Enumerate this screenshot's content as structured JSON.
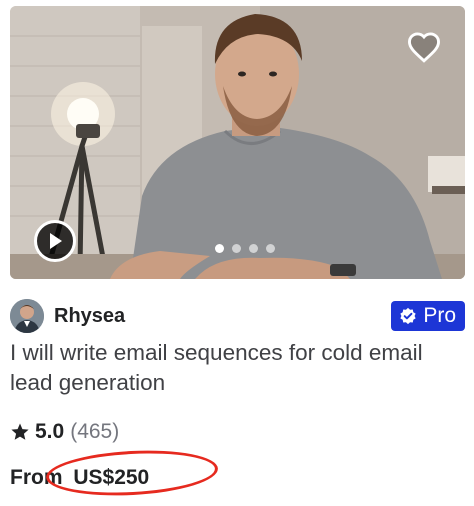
{
  "gig": {
    "seller_name": "Rhysea",
    "badge_label": "Pro",
    "title": "I will write email sequences for cold email lead generation",
    "rating": "5.0",
    "review_count": "(465)",
    "price_prefix": "From",
    "price": "US$250"
  },
  "media": {
    "slides": 4,
    "active_slide": 1
  },
  "icons": {
    "favorite": "heart-outline-icon",
    "play": "play-icon",
    "badge": "verified-check-icon",
    "rating": "star-icon"
  },
  "colors": {
    "badge_background": "#1d36d6",
    "annotation_circle": "#e62a1f",
    "text_primary": "#222325",
    "text_secondary": "#74767e"
  }
}
